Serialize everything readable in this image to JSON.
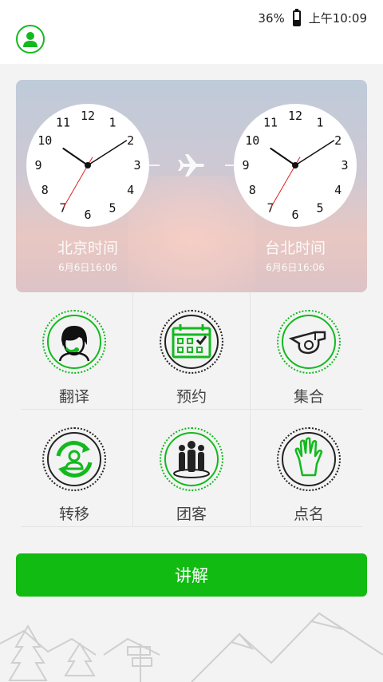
{
  "status_bar": {
    "battery_percent": "36%",
    "battery_level": 0.36,
    "time": "上午10:09"
  },
  "header": {
    "icon": "user-icon"
  },
  "world_clock": {
    "left": {
      "city": "北京时间",
      "date": "6月6日16:06",
      "hour": 10,
      "minute": 9,
      "second": 35
    },
    "right": {
      "city": "台北时间",
      "date": "6月6日16:06",
      "hour": 10,
      "minute": 9,
      "second": 35
    },
    "numerals": [
      "12",
      "1",
      "2",
      "3",
      "4",
      "5",
      "6",
      "7",
      "8",
      "9",
      "10",
      "11"
    ],
    "center_icon": "airplane-icon"
  },
  "menu": {
    "items": [
      {
        "label": "翻译",
        "icon": "headset-person-icon",
        "ring": "green"
      },
      {
        "label": "预约",
        "icon": "calendar-icon",
        "ring": "dark"
      },
      {
        "label": "集合",
        "icon": "whistle-icon",
        "ring": "green"
      },
      {
        "label": "转移",
        "icon": "transfer-person-icon",
        "ring": "dark"
      },
      {
        "label": "团客",
        "icon": "group-icon",
        "ring": "green"
      },
      {
        "label": "点名",
        "icon": "raised-hand-icon",
        "ring": "dark"
      }
    ]
  },
  "main_button": {
    "label": "讲解"
  },
  "colors": {
    "accent": "#11bb11",
    "ring_green": "#13b91e",
    "ring_dark": "#222222"
  }
}
